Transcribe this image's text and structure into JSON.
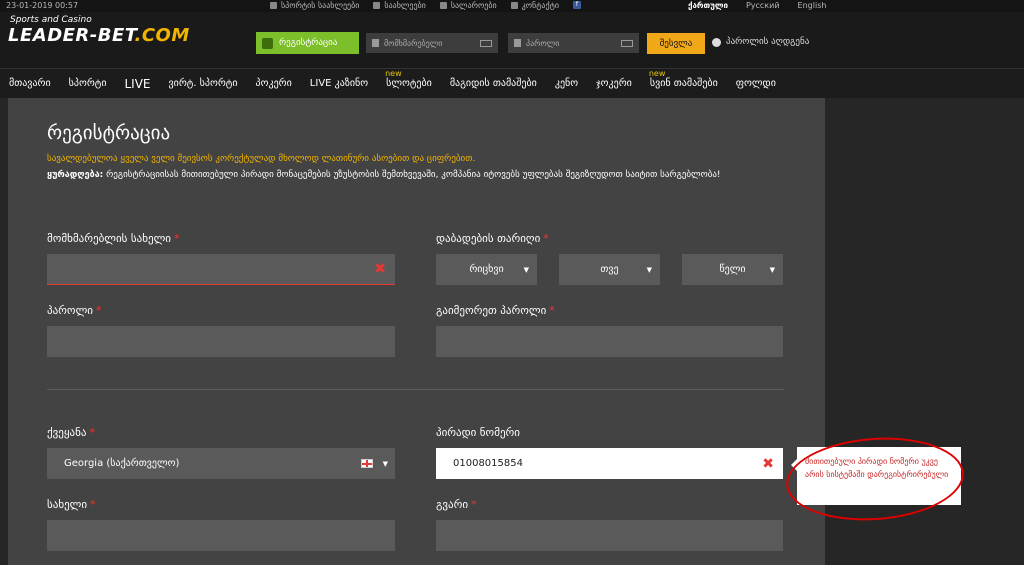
{
  "topbar": {
    "date": "23-01-2019 00:57",
    "links": [
      "სპორტის საახლეები",
      "საახლეები",
      "სალაროები",
      "კონტაქტი"
    ],
    "facebook": "f",
    "languages": [
      "ქართული",
      "Русский",
      "English"
    ]
  },
  "header": {
    "logo_tagline": "Sports and Casino",
    "logo_name": "LEADER-BET",
    "logo_domain": ".COM",
    "register_label": "რეგისტრაცია",
    "username_placeholder": "მომხმარებელი",
    "password_placeholder": "პაროლი",
    "login_label": "შესვლა",
    "recover_label": "პაროლის აღდგენა"
  },
  "nav": [
    {
      "label": "მთავარი",
      "new": ""
    },
    {
      "label": "სპორტი",
      "new": ""
    },
    {
      "label": "LIVE",
      "new": ""
    },
    {
      "label": "ვირტ. სპორტი",
      "new": ""
    },
    {
      "label": "პოკერი",
      "new": ""
    },
    {
      "label": "LIVE კაზინო",
      "new": ""
    },
    {
      "label": "სლოტები",
      "new": "new"
    },
    {
      "label": "მაგიდის თამაშები",
      "new": ""
    },
    {
      "label": "კენო",
      "new": ""
    },
    {
      "label": "ჯოკერი",
      "new": ""
    },
    {
      "label": "სვინ თამაშები",
      "new": "new"
    },
    {
      "label": "ფოლდი",
      "new": ""
    }
  ],
  "form": {
    "title": "რეგისტრაცია",
    "warning": "სავალდებულოა ყველა ველი შეივსოს კორექტულად მხოლოდ ლათინური ასოებით და ციფრებით.",
    "note_bold": "ყურადღება:",
    "note_text": " რეგისტრაციისას მითითებული პირადი მონაცემების უზუსტობის შემთხვევაში, კომპანია იტოვებს უფლებას შეგიზღუდოთ საიტით სარგებლობა!",
    "required_mark": "*",
    "username_label": "მომხმარებლის სახელი",
    "birthdate_label": "დაბადების თარიღი",
    "day_placeholder": "რიცხვი",
    "month_placeholder": "თვე",
    "year_placeholder": "წელი",
    "password_label": "პაროლი",
    "repeat_password_label": "გაიმეორეთ პაროლი",
    "country_label": "ქვეყანა",
    "country_value": "Georgia (საქართველო)",
    "personal_id_label": "პირადი ნომერი",
    "personal_id_value": "01008015854",
    "firstname_label": "სახელი",
    "lastname_label": "გვარი",
    "error_tooltip": "მითითებული პირადი ნომერი უკვე არის სისტემაში დარეგისტრირებული",
    "error_icon": "✖"
  }
}
